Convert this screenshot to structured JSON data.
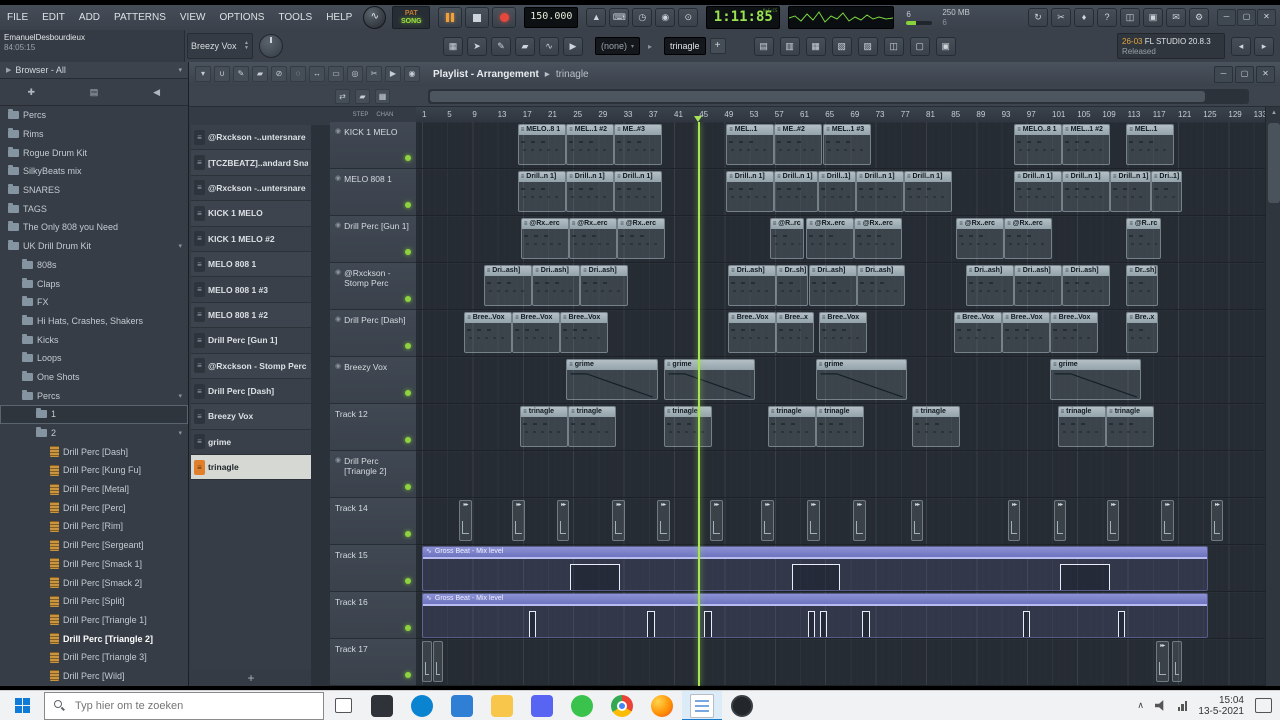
{
  "colors": {
    "led": "#8ed23f",
    "playhead": "#a8e455",
    "clip": "#9aa8b0",
    "automation": "#7076c0",
    "selection_orange": "#e0802c",
    "taskbar_accent": "#1979ca"
  },
  "menu": {
    "items": [
      "FILE",
      "EDIT",
      "ADD",
      "PATTERNS",
      "VIEW",
      "OPTIONS",
      "TOOLS",
      "HELP"
    ]
  },
  "transport": {
    "pat_label": "PAT",
    "song_label": "SONG",
    "tempo": "150.000",
    "time": "1:11:85",
    "time_unit": "M:S:CS"
  },
  "stats": {
    "value": "6",
    "mem": "250 MB",
    "cpu": "6"
  },
  "toolbar2": {
    "user_line1": "EmanuelDesbourdieux",
    "user_line2": "84:05:15",
    "pattern_selector": "Breezy Vox",
    "plugin_selector": "(none)",
    "arrangement_selector": "trinagle",
    "plus_label": "+",
    "hint_badge": "26-03",
    "hint_title": "FL STUDIO 20.8.3",
    "hint_sub": "Released",
    "breadcrumb_arrow": "▸"
  },
  "icons": {
    "transport_small": [
      {
        "name": "metronome-icon",
        "glyph": "▲"
      },
      {
        "name": "typing-keyboard-icon",
        "glyph": "⌨"
      },
      {
        "name": "wait-input-icon",
        "glyph": "◷"
      },
      {
        "name": "countdown-icon",
        "glyph": "◉"
      },
      {
        "name": "blend-recording-icon",
        "glyph": "⊙"
      }
    ],
    "system": [
      {
        "name": "sync-icon",
        "glyph": "↻"
      },
      {
        "name": "cut-icon",
        "glyph": "✂"
      },
      {
        "name": "mic-icon",
        "glyph": "♦"
      },
      {
        "name": "help-icon",
        "glyph": "?"
      },
      {
        "name": "save-icon",
        "glyph": "◫"
      },
      {
        "name": "monitor-icon",
        "glyph": "▣"
      },
      {
        "name": "chat-icon",
        "glyph": "✉"
      },
      {
        "name": "settings-icon",
        "glyph": "⚙"
      }
    ],
    "toolbar2": [
      {
        "name": "snap-grid-icon",
        "glyph": "▦"
      },
      {
        "name": "cursor-icon",
        "glyph": "➤"
      },
      {
        "name": "pencil-icon",
        "glyph": "✎"
      },
      {
        "name": "paint-icon",
        "glyph": "▰"
      },
      {
        "name": "slip-icon",
        "glyph": "∿"
      },
      {
        "name": "audition-icon",
        "glyph": "▶"
      }
    ],
    "views": [
      {
        "name": "playlist-view-icon",
        "glyph": "▤"
      },
      {
        "name": "piano-roll-icon",
        "glyph": "▥"
      },
      {
        "name": "channel-rack-icon",
        "glyph": "▦"
      },
      {
        "name": "mixer-icon",
        "glyph": "▧"
      },
      {
        "name": "browser-view-icon",
        "glyph": "▨"
      },
      {
        "name": "plugin-picker-icon",
        "glyph": "◫"
      },
      {
        "name": "touch-controller-icon",
        "glyph": "▢"
      },
      {
        "name": "project-picker-icon",
        "glyph": "▣"
      }
    ],
    "playlist_tools": [
      {
        "name": "playlist-menu-icon",
        "glyph": "▾"
      },
      {
        "name": "magnet-icon",
        "glyph": "∪"
      },
      {
        "name": "pencil-icon",
        "glyph": "✎"
      },
      {
        "name": "paint-icon",
        "glyph": "▰"
      },
      {
        "name": "delete-icon",
        "glyph": "⊘"
      },
      {
        "name": "mute-icon",
        "glyph": "◌"
      },
      {
        "name": "slip-icon",
        "glyph": "↔"
      },
      {
        "name": "select-icon",
        "glyph": "▭"
      },
      {
        "name": "zoom-icon",
        "glyph": "◎"
      },
      {
        "name": "cut-icon",
        "glyph": "✂"
      },
      {
        "name": "playback-icon",
        "glyph": "▶"
      },
      {
        "name": "preview-icon",
        "glyph": "◉"
      }
    ],
    "playlist_row2": [
      {
        "name": "swap-icon",
        "glyph": "⇄"
      },
      {
        "name": "layers-icon",
        "glyph": "▰"
      },
      {
        "name": "grid-icon",
        "glyph": "▦"
      }
    ],
    "browser_tabs": [
      {
        "name": "add-tab-icon",
        "glyph": "✚"
      },
      {
        "name": "files-tab-icon",
        "glyph": "▤"
      },
      {
        "name": "audition-tab-icon",
        "glyph": "◀"
      }
    ]
  },
  "browser": {
    "title": "Browser - All",
    "items": [
      {
        "label": "Percs",
        "level": 0,
        "type": "folder"
      },
      {
        "label": "Rims",
        "level": 0,
        "type": "folder"
      },
      {
        "label": "Rogue Drum Kit",
        "level": 0,
        "type": "folder"
      },
      {
        "label": "SilkyBeats mix",
        "level": 0,
        "type": "folder"
      },
      {
        "label": "SNARES",
        "level": 0,
        "type": "folder"
      },
      {
        "label": "TAGS",
        "level": 0,
        "type": "folder"
      },
      {
        "label": "The Only 808 you Need",
        "level": 0,
        "type": "folder"
      },
      {
        "label": "UK Drill Drum Kit",
        "level": 0,
        "type": "folder",
        "expanded": true
      },
      {
        "label": "808s",
        "level": 1,
        "type": "folder"
      },
      {
        "label": "Claps",
        "level": 1,
        "type": "folder"
      },
      {
        "label": "FX",
        "level": 1,
        "type": "folder"
      },
      {
        "label": "Hi Hats, Crashes, Shakers",
        "level": 1,
        "type": "folder"
      },
      {
        "label": "Kicks",
        "level": 1,
        "type": "folder"
      },
      {
        "label": "Loops",
        "level": 1,
        "type": "folder"
      },
      {
        "label": "One Shots",
        "level": 1,
        "type": "folder"
      },
      {
        "label": "Percs",
        "level": 1,
        "type": "folder",
        "expanded": true
      },
      {
        "label": "1",
        "level": 2,
        "type": "folder",
        "boxed": true
      },
      {
        "label": "2",
        "level": 2,
        "type": "folder",
        "expanded": true
      },
      {
        "label": "Drill Perc [Dash]",
        "level": 3,
        "type": "file"
      },
      {
        "label": "Drill Perc [Kung Fu]",
        "level": 3,
        "type": "file"
      },
      {
        "label": "Drill Perc [Metal]",
        "level": 3,
        "type": "file"
      },
      {
        "label": "Drill Perc [Perc]",
        "level": 3,
        "type": "file"
      },
      {
        "label": "Drill Perc [Rim]",
        "level": 3,
        "type": "file"
      },
      {
        "label": "Drill Perc [Sergeant]",
        "level": 3,
        "type": "file"
      },
      {
        "label": "Drill Perc [Smack 1]",
        "level": 3,
        "type": "file"
      },
      {
        "label": "Drill Perc [Smack 2]",
        "level": 3,
        "type": "file"
      },
      {
        "label": "Drill Perc [Split]",
        "level": 3,
        "type": "file"
      },
      {
        "label": "Drill Perc [Triangle 1]",
        "level": 3,
        "type": "file"
      },
      {
        "label": "Drill Perc [Triangle 2]",
        "level": 3,
        "type": "file",
        "selected": true
      },
      {
        "label": "Drill Perc [Triangle 3]",
        "level": 3,
        "type": "file"
      },
      {
        "label": "Drill Perc [Wild]",
        "level": 3,
        "type": "file"
      }
    ]
  },
  "playlist": {
    "title": "Playlist - Arrangement",
    "subtitle": "trinagle",
    "breadcrumb_arrow": "▸",
    "mode_labels": [
      "STEP",
      "CHAN"
    ],
    "add_button": "+",
    "ruler": {
      "start": 1,
      "step": 4,
      "end": 133
    },
    "playhead_bar": 44.8,
    "patterns": [
      {
        "label": "@Rxckson -..untersnare"
      },
      {
        "label": "[TCZBEATZ]..andard Snare"
      },
      {
        "label": "@Rxckson -..untersnare"
      },
      {
        "label": "KICK 1 MELO"
      },
      {
        "label": "KICK 1 MELO #2"
      },
      {
        "label": "MELO 808 1"
      },
      {
        "label": "MELO 808 1 #3"
      },
      {
        "label": "MELO 808 1 #2"
      },
      {
        "label": "Drill Perc [Gun 1]"
      },
      {
        "label": "@Rxckson - Stomp Perc"
      },
      {
        "label": "Drill Perc [Dash]"
      },
      {
        "label": "Breezy Vox"
      },
      {
        "label": "grime"
      },
      {
        "label": "trinagle",
        "selected": true
      }
    ],
    "tracks": [
      {
        "name": "KICK 1 MELO",
        "icon": true,
        "clips": [
          {
            "b": 16.2,
            "w": 7.6,
            "l": "MELO..8 1"
          },
          {
            "b": 23.9,
            "w": 7.6,
            "l": "MEL..1 #2"
          },
          {
            "b": 31.5,
            "w": 7.6,
            "l": "ME..#3"
          },
          {
            "b": 49.3,
            "w": 7.6,
            "l": "MEL..1"
          },
          {
            "b": 56.9,
            "w": 7.6,
            "l": "ME..#2"
          },
          {
            "b": 64.7,
            "w": 7.6,
            "l": "MEL..1 #3"
          },
          {
            "b": 95.0,
            "w": 7.6,
            "l": "MELO..8 1"
          },
          {
            "b": 102.6,
            "w": 7.6,
            "l": "MEL..1 #2"
          },
          {
            "b": 112.8,
            "w": 7.6,
            "l": "MEL..1"
          }
        ]
      },
      {
        "name": "MELO 808 1",
        "icon": true,
        "clips": [
          {
            "b": 16.2,
            "w": 7.6,
            "l": "Drill..n 1]"
          },
          {
            "b": 23.9,
            "w": 7.6,
            "l": "Drill..n 1]"
          },
          {
            "b": 31.5,
            "w": 7.6,
            "l": "Drill..n 1]"
          },
          {
            "b": 49.3,
            "w": 7.6,
            "l": "Drill..n 1]"
          },
          {
            "b": 56.9,
            "w": 6.9,
            "l": "Drill..n 1]"
          },
          {
            "b": 63.9,
            "w": 6.0,
            "l": "Drill..1]"
          },
          {
            "b": 69.9,
            "w": 7.6,
            "l": "Drill..n 1]"
          },
          {
            "b": 77.5,
            "w": 7.6,
            "l": "Drill..n 1]"
          },
          {
            "b": 95.0,
            "w": 7.6,
            "l": "Drill..n 1]"
          },
          {
            "b": 102.6,
            "w": 7.6,
            "l": "Drill..n 1]"
          },
          {
            "b": 110.2,
            "w": 6.5,
            "l": "Drill..n 1]"
          },
          {
            "b": 116.7,
            "w": 5.0,
            "l": "Dri..1]"
          }
        ]
      },
      {
        "name": "Drill Perc [Gun 1]",
        "icon": true,
        "clips": [
          {
            "b": 16.7,
            "w": 7.6,
            "l": "@Rx..erc"
          },
          {
            "b": 24.3,
            "w": 7.6,
            "l": "@Rx..erc"
          },
          {
            "b": 32.0,
            "w": 7.6,
            "l": "@Rx..erc"
          },
          {
            "b": 56.2,
            "w": 5.5,
            "l": "@R..rc"
          },
          {
            "b": 62.0,
            "w": 7.6,
            "l": "@Rx..erc"
          },
          {
            "b": 69.6,
            "w": 7.6,
            "l": "@Rx..erc"
          },
          {
            "b": 85.8,
            "w": 7.6,
            "l": "@Rx..erc"
          },
          {
            "b": 93.4,
            "w": 7.6,
            "l": "@Rx..erc"
          },
          {
            "b": 112.8,
            "w": 5.5,
            "l": "@R..rc"
          }
        ]
      },
      {
        "name": "@Rxckson -",
        "name2": "Stomp Perc",
        "icon": true,
        "clips": [
          {
            "b": 10.8,
            "w": 7.6,
            "l": "Dri..ash]"
          },
          {
            "b": 18.5,
            "w": 7.6,
            "l": "Dri..ash]"
          },
          {
            "b": 26.1,
            "w": 7.6,
            "l": "Dri..ash]"
          },
          {
            "b": 49.6,
            "w": 7.6,
            "l": "Dri..ash]"
          },
          {
            "b": 57.2,
            "w": 5.0,
            "l": "Dr..sh]"
          },
          {
            "b": 62.4,
            "w": 7.6,
            "l": "Dri..ash]"
          },
          {
            "b": 70.0,
            "w": 7.6,
            "l": "Dri..ash]"
          },
          {
            "b": 87.3,
            "w": 7.6,
            "l": "Dri..ash]"
          },
          {
            "b": 95.0,
            "w": 7.6,
            "l": "Dri..ash]"
          },
          {
            "b": 102.6,
            "w": 7.6,
            "l": "Dri..ash]"
          },
          {
            "b": 112.8,
            "w": 5.0,
            "l": "Dr..sh]"
          }
        ]
      },
      {
        "name": "Drill Perc [Dash]",
        "icon": true,
        "clips": [
          {
            "b": 7.7,
            "w": 7.6,
            "l": "Bree..Vox"
          },
          {
            "b": 15.3,
            "w": 7.6,
            "l": "Bree..Vox"
          },
          {
            "b": 22.9,
            "w": 7.6,
            "l": "Bree..Vox"
          },
          {
            "b": 49.6,
            "w": 7.6,
            "l": "Bree..Vox"
          },
          {
            "b": 57.2,
            "w": 6.0,
            "l": "Bree..x"
          },
          {
            "b": 64.0,
            "w": 7.6,
            "l": "Bree..Vox"
          },
          {
            "b": 85.4,
            "w": 7.6,
            "l": "Bree..Vox"
          },
          {
            "b": 93.1,
            "w": 7.6,
            "l": "Bree..Vox"
          },
          {
            "b": 100.7,
            "w": 7.6,
            "l": "Bree..Vox"
          },
          {
            "b": 112.8,
            "w": 5.0,
            "l": "Bre..x"
          }
        ]
      },
      {
        "name": "Breezy Vox",
        "icon": true,
        "clips": [
          {
            "b": 23.9,
            "w": 14.5,
            "l": "grime",
            "t": "fade"
          },
          {
            "b": 39.4,
            "w": 14.5,
            "l": "grime",
            "t": "fade"
          },
          {
            "b": 63.5,
            "w": 14.5,
            "l": "grime",
            "t": "fade"
          },
          {
            "b": 100.7,
            "w": 14.5,
            "l": "grime",
            "t": "fade"
          }
        ]
      },
      {
        "name": "Track 12",
        "clips": [
          {
            "b": 16.6,
            "w": 7.6,
            "l": "trinagle"
          },
          {
            "b": 24.2,
            "w": 7.6,
            "l": "trinagle"
          },
          {
            "b": 39.4,
            "w": 7.6,
            "l": "trinagle"
          },
          {
            "b": 55.9,
            "w": 7.6,
            "l": "trinagle"
          },
          {
            "b": 63.5,
            "w": 7.6,
            "l": "trinagle"
          },
          {
            "b": 78.8,
            "w": 7.6,
            "l": "trinagle"
          },
          {
            "b": 101.9,
            "w": 7.6,
            "l": "trinagle"
          },
          {
            "b": 109.6,
            "w": 7.6,
            "l": "trinagle"
          }
        ]
      },
      {
        "name": "Drill Perc",
        "name2": "[Triangle 2]",
        "icon": true,
        "clips": []
      },
      {
        "name": "Track 14",
        "clips": [
          {
            "b": 6.9,
            "w": 2,
            "t": "mini"
          },
          {
            "b": 15.3,
            "w": 2,
            "t": "mini"
          },
          {
            "b": 22.4,
            "w": 2,
            "t": "mini"
          },
          {
            "b": 31.2,
            "w": 2,
            "t": "mini"
          },
          {
            "b": 38.3,
            "w": 2,
            "t": "mini"
          },
          {
            "b": 46.7,
            "w": 2,
            "t": "mini"
          },
          {
            "b": 54.8,
            "w": 2,
            "t": "mini"
          },
          {
            "b": 62.1,
            "w": 2,
            "t": "mini"
          },
          {
            "b": 69.4,
            "w": 2,
            "t": "mini"
          },
          {
            "b": 78.6,
            "w": 2,
            "t": "mini"
          },
          {
            "b": 94.0,
            "w": 2,
            "t": "mini"
          },
          {
            "b": 101.3,
            "w": 2,
            "t": "mini"
          },
          {
            "b": 109.7,
            "w": 2,
            "t": "mini"
          },
          {
            "b": 118.3,
            "w": 2,
            "t": "mini"
          },
          {
            "b": 126.2,
            "w": 2,
            "t": "mini"
          }
        ]
      },
      {
        "name": "Track 15",
        "clips": [
          {
            "b": 1,
            "w": 124.8,
            "l": "Gross Beat - Mix level",
            "t": "automation",
            "pulses": [
              {
                "b": 24.3,
                "w": 8
              },
              {
                "b": 59.6,
                "w": 7.6
              },
              {
                "b": 102.1,
                "w": 8
              }
            ]
          }
        ]
      },
      {
        "name": "Track 16",
        "clips": [
          {
            "b": 1,
            "w": 124.8,
            "l": "Gross Beat - Mix level",
            "t": "automation",
            "pulses": [
              {
                "b": 17.8,
                "w": 1.2
              },
              {
                "b": 36.6,
                "w": 1.2
              },
              {
                "b": 45.6,
                "w": 1.2
              },
              {
                "b": 62.1,
                "w": 1.2
              },
              {
                "b": 64.0,
                "w": 1.2
              },
              {
                "b": 70.7,
                "w": 1.2
              },
              {
                "b": 96.2,
                "w": 1.2
              },
              {
                "b": 111.3,
                "w": 1.2
              }
            ]
          }
        ]
      },
      {
        "name": "Track 17",
        "clips": [
          {
            "b": 1.0,
            "w": 1.6,
            "t": "audio"
          },
          {
            "b": 2.8,
            "w": 1.6,
            "t": "audio"
          },
          {
            "b": 117.5,
            "w": 2,
            "t": "mini"
          },
          {
            "b": 120.0,
            "w": 1.6,
            "t": "audio"
          }
        ]
      }
    ]
  },
  "taskbar": {
    "search_placeholder": "Typ hier om te zoeken",
    "time": "15:04",
    "date": "13-5-2021",
    "apps": [
      {
        "name": "bluestacks",
        "color": "#2f3238"
      },
      {
        "name": "edge",
        "color": "#0a84d0"
      },
      {
        "name": "mail",
        "color": "#2f7fd4"
      },
      {
        "name": "explorer",
        "color": "#f7c64a"
      },
      {
        "name": "discord",
        "color": "#5865f2"
      },
      {
        "name": "whatsapp",
        "color": "#3ac34c"
      },
      {
        "name": "chrome",
        "color": ""
      },
      {
        "name": "firefox",
        "color": ""
      },
      {
        "name": "word-doc",
        "color": "#ffffff",
        "active": true
      },
      {
        "name": "obs",
        "color": "#23262a"
      }
    ]
  }
}
